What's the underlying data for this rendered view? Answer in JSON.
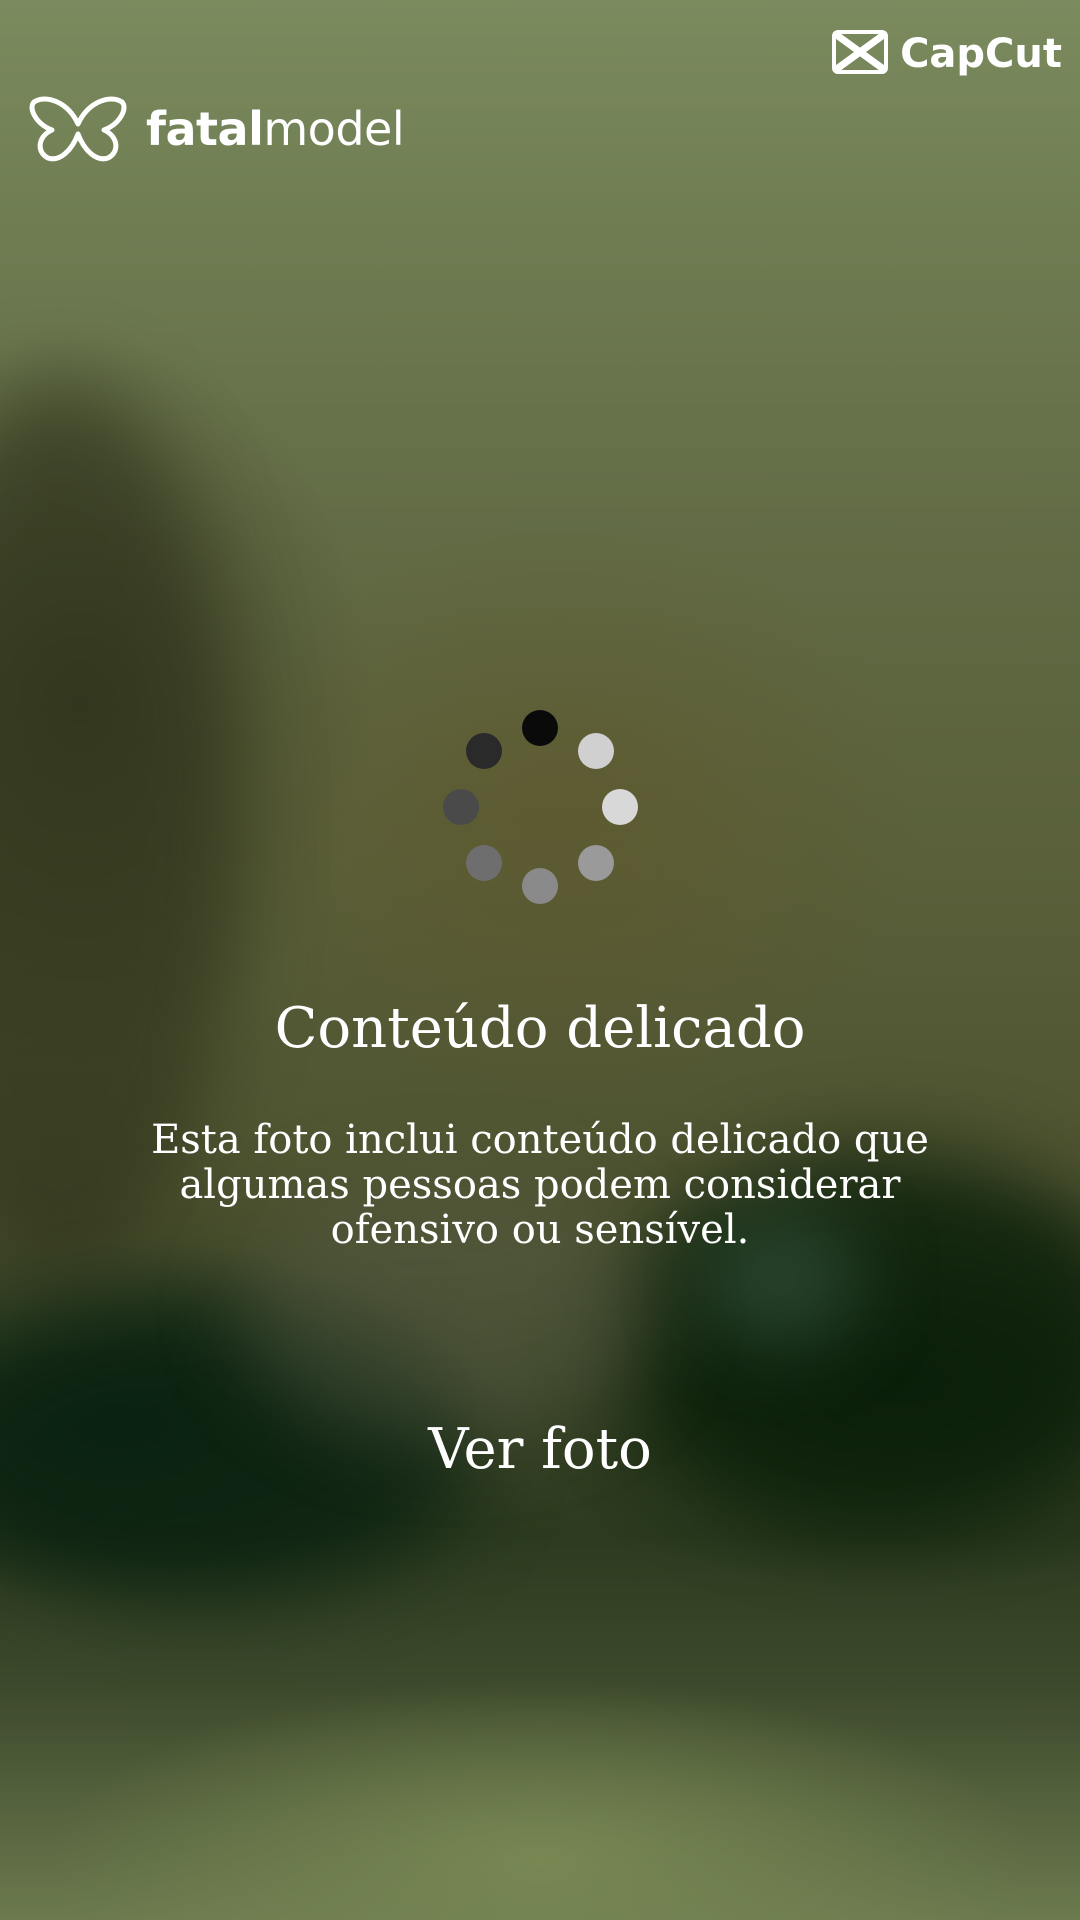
{
  "branding": {
    "logo_bold": "fatal",
    "logo_light": "model",
    "watermark": "CapCut",
    "logo_icon": "butterfly-icon",
    "watermark_icon": "capcut-icon"
  },
  "loading": {
    "icon": "spinner-icon"
  },
  "warning": {
    "title": "Conteúdo delicado",
    "description": "Esta foto inclui conteúdo delicado que algumas pessoas podem considerar ofensivo ou sensível.",
    "action_label": "Ver foto"
  },
  "colors": {
    "text": "#ffffff",
    "background": "#5b6440"
  }
}
